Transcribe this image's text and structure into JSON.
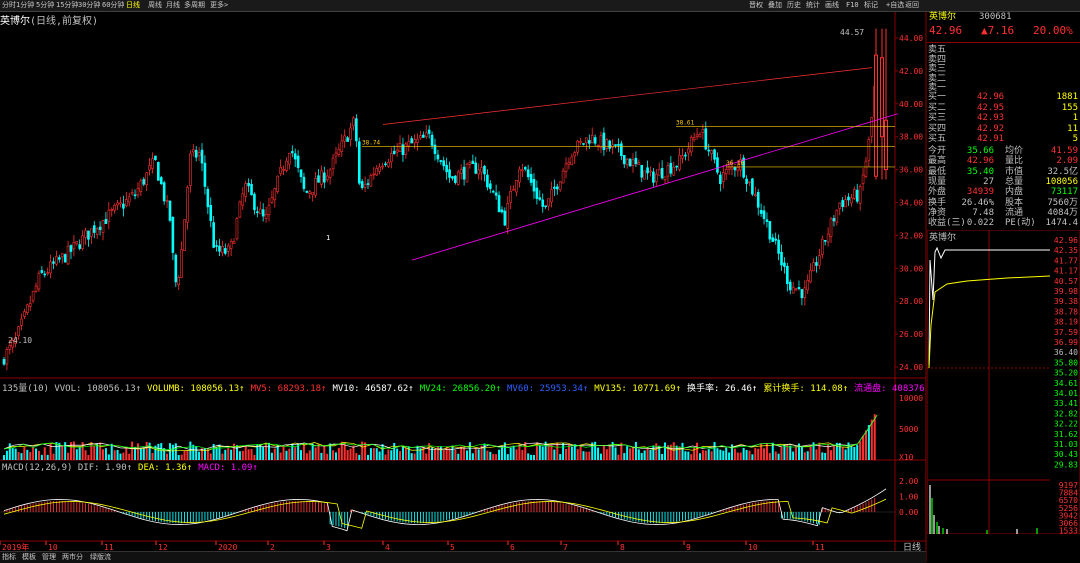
{
  "topbar": {
    "left_items": [
      "分时",
      "1分钟",
      "5分钟",
      "15分钟",
      "30分钟",
      "60分钟",
      "日线",
      "周线",
      "月线",
      "多周期",
      "更多>"
    ],
    "active": "日线",
    "right_items": [
      "晋权",
      "叠加",
      "历史",
      "统计",
      "画线",
      "F10",
      "标记",
      "+自选",
      "返回"
    ]
  },
  "title": {
    "name": "英博尔",
    "params": "(日线,前复权)"
  },
  "price_axis": [
    "44.00",
    "42.00",
    "40.00",
    "38.00",
    "36.00",
    "34.00",
    "32.00",
    "30.00",
    "28.00",
    "26.00",
    "24.00"
  ],
  "annotations": {
    "high": "44.57",
    "low": "24.10",
    "lv1": "38.74",
    "lv2": "38.61",
    "lv3": "36.16",
    "marker_top": "↓",
    "marker_bottom": "1"
  },
  "volume_panel": {
    "status": [
      {
        "t": "135量(10) VVOL: 108056.13↑",
        "c": "#c0c0c0"
      },
      {
        "t": "VOLUMB: 108056.13↑",
        "c": "#ffff00"
      },
      {
        "t": "MV5: 68293.18↑",
        "c": "#ff3030"
      },
      {
        "t": "MV10: 46587.62↑",
        "c": "#ffffff"
      },
      {
        "t": "MV24: 26856.20↑",
        "c": "#00ff00"
      },
      {
        "t": "MV60: 25953.34↑",
        "c": "#3060ff"
      },
      {
        "t": "MV135: 10771.69↑",
        "c": "#ffff00"
      },
      {
        "t": "换手率: 26.46↑",
        "c": "#ffffff"
      },
      {
        "t": "累计换手: 114.08↑",
        "c": "#ffff00"
      },
      {
        "t": "流通盘: 408376",
        "c": "#ff00ff"
      }
    ],
    "axis": [
      "10000",
      "5000",
      "X10"
    ]
  },
  "macd_panel": {
    "status": [
      {
        "t": "MACD(12,26,9) DIF: 1.90↑",
        "c": "#c0c0c0"
      },
      {
        "t": "DEA: 1.36↑",
        "c": "#ffff00"
      },
      {
        "t": "MACD: 1.09↑",
        "c": "#ff00ff"
      }
    ],
    "axis": [
      "2.00",
      "1.00",
      "0.00"
    ]
  },
  "date_axis": [
    "2019年",
    "10",
    "11",
    "12",
    "2020",
    "2",
    "3",
    "4",
    "5",
    "6",
    "7",
    "8",
    "9",
    "10",
    "11"
  ],
  "date_end": "日线",
  "bottom_tabs": [
    "指标",
    "模板",
    "管理",
    "两市分",
    "绿版流"
  ],
  "right_panel": {
    "name": "英博尔",
    "code": "300681",
    "price": "42.96",
    "change": "▲7.16",
    "pct": "20.00%",
    "asks": [
      {
        "label": "卖五",
        "price": "",
        "vol": ""
      },
      {
        "label": "卖四",
        "price": "",
        "vol": ""
      },
      {
        "label": "卖三",
        "price": "",
        "vol": ""
      },
      {
        "label": "卖二",
        "price": "",
        "vol": ""
      },
      {
        "label": "卖一",
        "price": "",
        "vol": ""
      }
    ],
    "bids": [
      {
        "label": "买一",
        "price": "42.96",
        "vol": "1881"
      },
      {
        "label": "买二",
        "price": "42.95",
        "vol": "155"
      },
      {
        "label": "买三",
        "price": "42.93",
        "vol": "1"
      },
      {
        "label": "买四",
        "price": "42.92",
        "vol": "11"
      },
      {
        "label": "买五",
        "price": "42.91",
        "vol": "5"
      }
    ],
    "stats": [
      {
        "l1": "今开",
        "v1": "35.66",
        "c1": "#00ff00",
        "l2": "均价",
        "v2": "41.59",
        "c2": "#ff3030"
      },
      {
        "l1": "最高",
        "v1": "42.96",
        "c1": "#ff3030",
        "l2": "量比",
        "v2": "2.09",
        "c2": "#ff3030"
      },
      {
        "l1": "最低",
        "v1": "35.40",
        "c1": "#00ff00",
        "l2": "市值",
        "v2": "32.5亿",
        "c2": "#c0c0c0"
      },
      {
        "l1": "现量",
        "v1": "27",
        "c1": "#c0c0c0",
        "l2": "总量",
        "v2": "108056",
        "c2": "#ffff00"
      },
      {
        "l1": "外盘",
        "v1": "34939",
        "c1": "#ff3030",
        "l2": "内盘",
        "v2": "73117",
        "c2": "#00ff00"
      },
      {
        "l1": "换手",
        "v1": "26.46%",
        "c1": "#c0c0c0",
        "l2": "股本",
        "v2": "7560万",
        "c2": "#c0c0c0"
      },
      {
        "l1": "净资",
        "v1": "7.48",
        "c1": "#c0c0c0",
        "l2": "流通",
        "v2": "4084万",
        "c2": "#c0c0c0"
      },
      {
        "l1": "收益(三)",
        "v1": "0.022",
        "c1": "#c0c0c0",
        "l2": "PE(动)",
        "v2": "1474.4",
        "c2": "#c0c0c0"
      }
    ],
    "mini_name": "英博尔",
    "mini_axis": [
      "42.96",
      "42.35",
      "41.77",
      "41.17",
      "40.57",
      "39.98",
      "39.38",
      "38.78",
      "38.19",
      "37.59",
      "36.99",
      "36.40",
      "35.80",
      "35.20",
      "34.61",
      "34.01",
      "33.41",
      "32.82",
      "32.22",
      "31.62",
      "31.03",
      "30.43",
      "29.83"
    ],
    "mini_vol_axis": [
      "9197",
      "7884",
      "6570",
      "5256",
      "3942",
      "3066",
      "1533"
    ]
  }
}
